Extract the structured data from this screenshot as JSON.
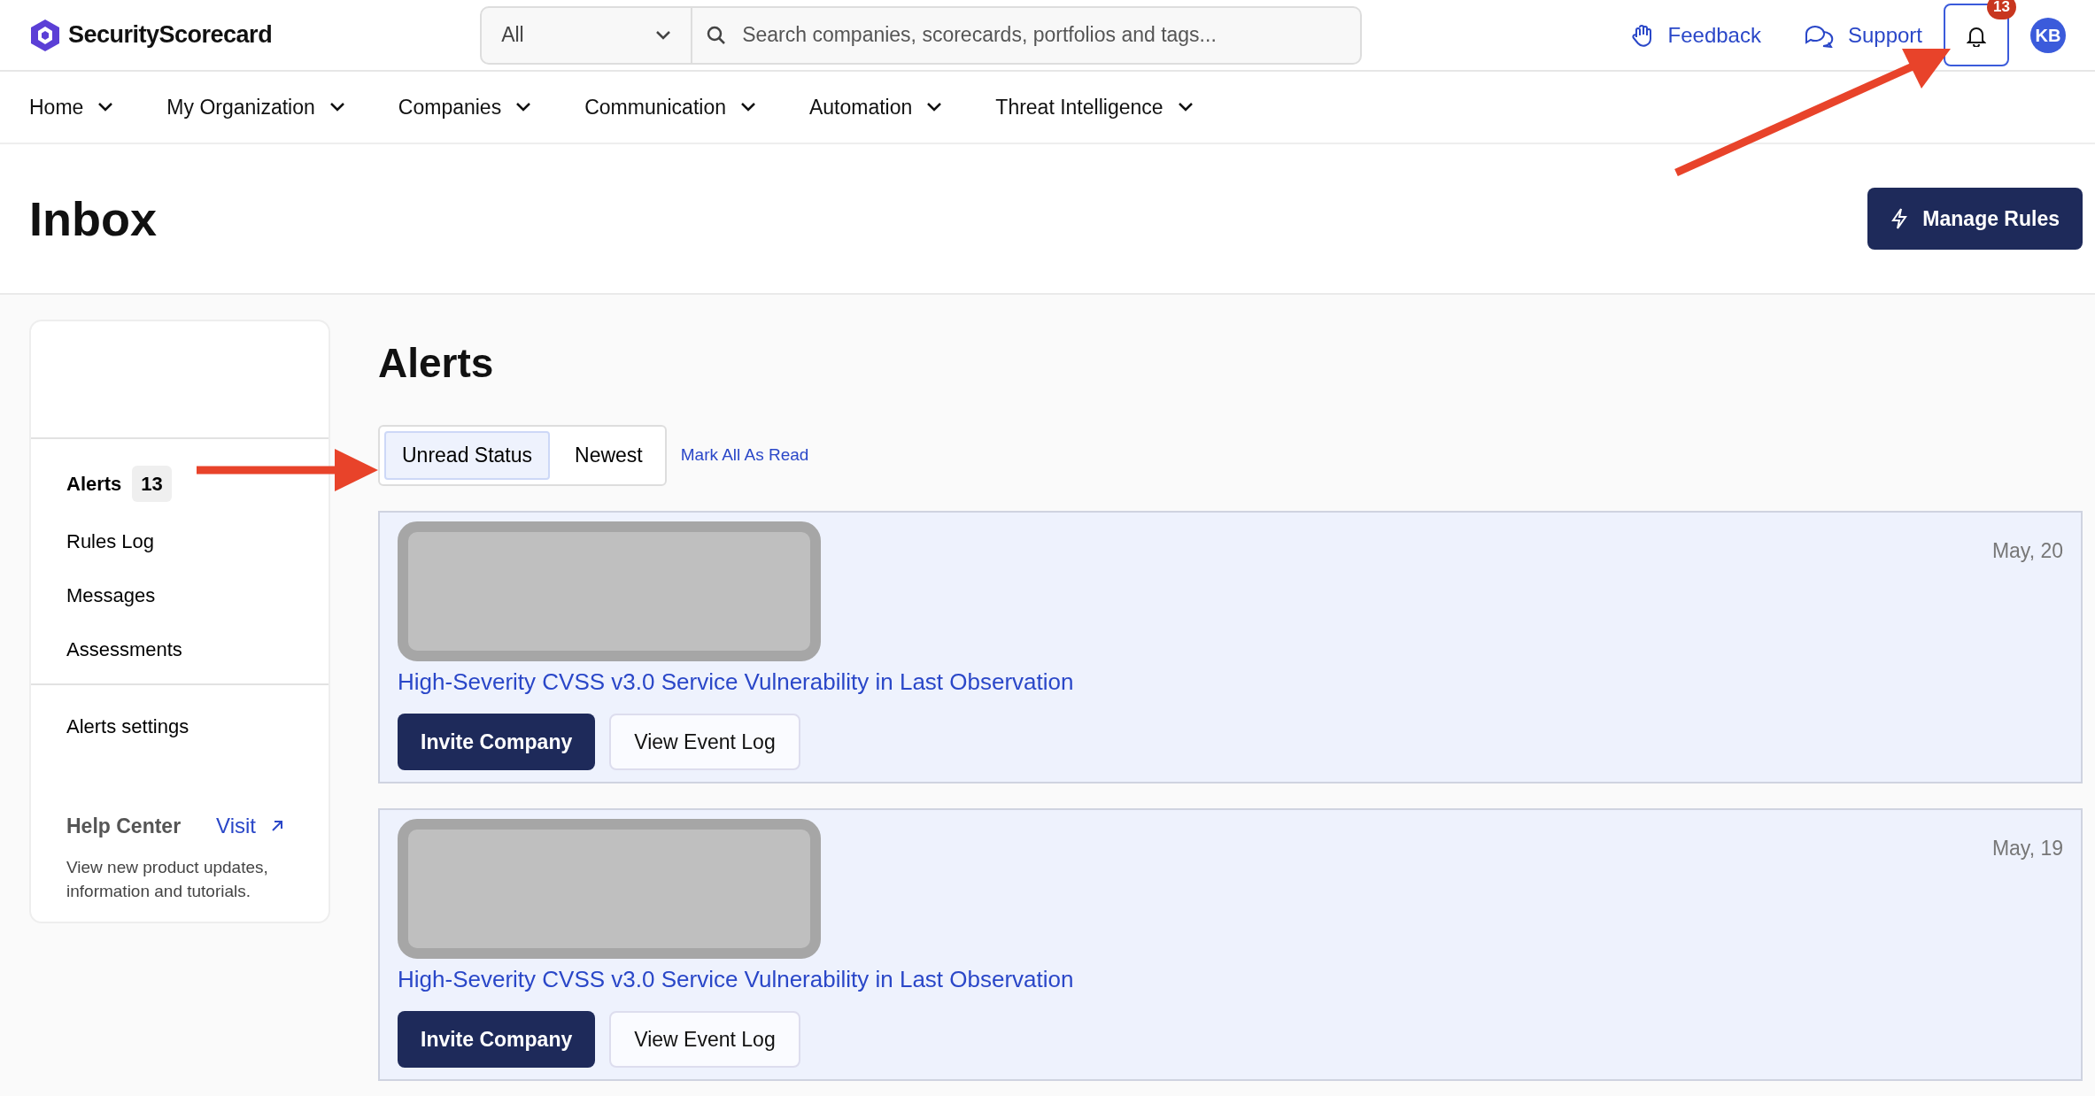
{
  "header": {
    "logo": "SecurityScorecard",
    "search_scope": "All",
    "search": {
      "placeholder": "Search companies, scorecards, portfolios and tags..."
    },
    "links": [
      {
        "label": "Feedback",
        "kind": "feedback"
      },
      {
        "label": "Support",
        "kind": "support"
      }
    ],
    "notifications": {
      "count": "13"
    },
    "avatar": "KB"
  },
  "nav": [
    {
      "label": "Home"
    },
    {
      "label": "My Organization"
    },
    {
      "label": "Companies"
    },
    {
      "label": "Communication"
    },
    {
      "label": "Automation"
    },
    {
      "label": "Threat Intelligence"
    }
  ],
  "page": {
    "title": "Inbox",
    "action": "Manage Rules"
  },
  "sidebar": {
    "items": [
      {
        "label": "Alerts",
        "count": "13",
        "selected": true
      },
      {
        "label": "Rules Log",
        "selected": false
      },
      {
        "label": "Messages",
        "selected": false
      },
      {
        "label": "Assessments",
        "selected": false
      }
    ],
    "settings": "Alerts settings",
    "help": {
      "title": "Help Center",
      "link": "Visit",
      "text": "View new product updates, information and tutorials."
    }
  },
  "alerts": {
    "title": "Alerts",
    "sort": [
      {
        "label": "Unread Status",
        "selected": true
      },
      {
        "label": "Newest",
        "selected": false
      }
    ],
    "mark_all": "Mark All As Read",
    "items": [
      {
        "date": "May, 20",
        "title": "High-Severity CVSS v3.0 Service Vulnerability in Last Observation",
        "unread": true,
        "buttons": [
          "Invite Company",
          "View Event Log"
        ]
      },
      {
        "date": "May, 19",
        "title": "High-Severity CVSS v3.0 Service Vulnerability in Last Observation",
        "unread": true,
        "buttons": [
          "Invite Company",
          "View Event Log"
        ]
      }
    ]
  }
}
